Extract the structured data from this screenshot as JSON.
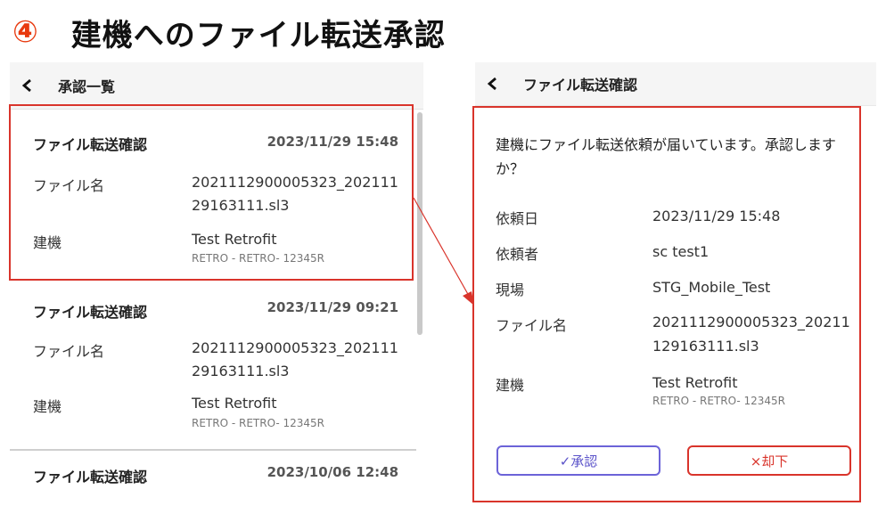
{
  "heading": {
    "number": "④",
    "title": "建機へのファイル転送承認"
  },
  "left": {
    "header_title": "承認一覧",
    "cards": [
      {
        "title": "ファイル転送確認",
        "date": "2023/11/29 15:48",
        "file_label": "ファイル名",
        "file_value": "2021112900005323_20211129163111.sl3",
        "machine_label": "建機",
        "machine_value": "Test Retrofit",
        "machine_sub": "RETRO - RETRO- 12345R"
      },
      {
        "title": "ファイル転送確認",
        "date": "2023/11/29 09:21",
        "file_label": "ファイル名",
        "file_value": "2021112900005323_20211129163111.sl3",
        "machine_label": "建機",
        "machine_value": "Test Retrofit",
        "machine_sub": "RETRO - RETRO- 12345R"
      },
      {
        "title": "ファイル転送確認",
        "date": "2023/10/06 12:48"
      }
    ]
  },
  "right": {
    "header_title": "ファイル転送確認",
    "message": "建機にファイル転送依頼が届いています。承認しますか？",
    "rows": [
      {
        "label": "依頼日",
        "value": "2023/11/29 15:48"
      },
      {
        "label": "依頼者",
        "value": "sc test1"
      },
      {
        "label": "現場",
        "value": "STG_Mobile_Test"
      },
      {
        "label": "ファイル名",
        "value": "2021112900005323_20211129163111.sl3"
      },
      {
        "label": "建機",
        "value": "Test Retrofit",
        "sub": "RETRO - RETRO- 12345R"
      }
    ],
    "approve_label": "✓承認",
    "reject_label": "×却下"
  },
  "colors": {
    "highlight": "#d9342b",
    "approve": "#6c63d8",
    "reject": "#d9342b",
    "number": "#e8390e"
  },
  "icons": {
    "back": "chevron-left-icon",
    "arrow": "arrow-connector-icon"
  }
}
